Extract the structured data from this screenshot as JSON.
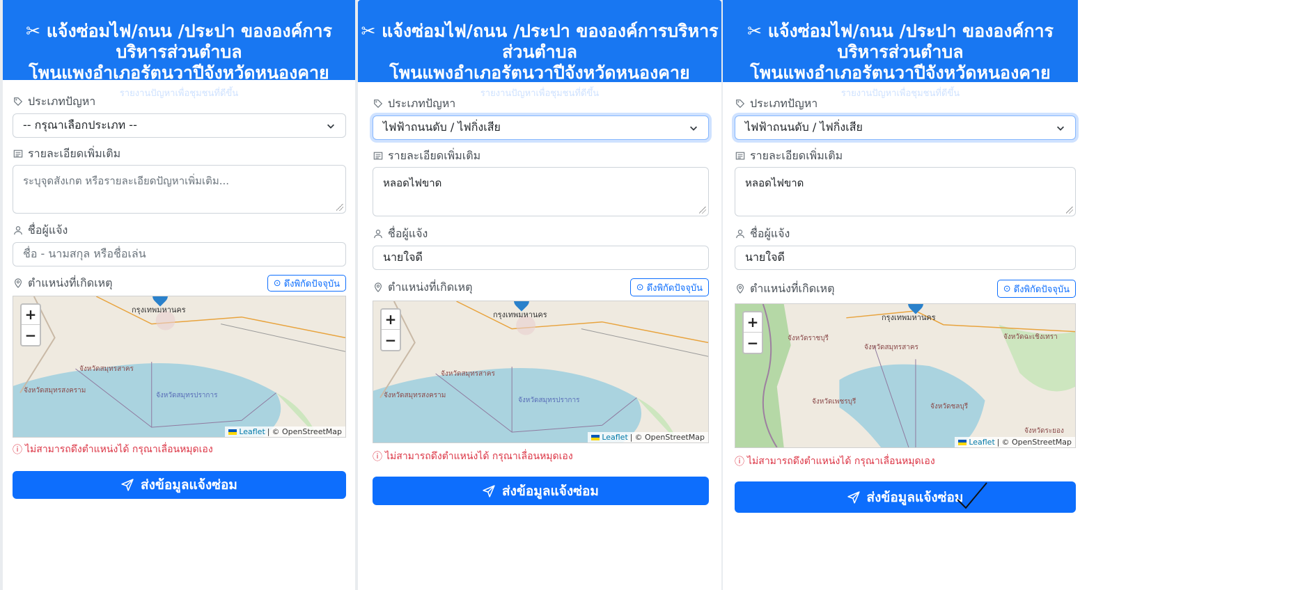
{
  "header": {
    "title_line1": "แจ้งซ่อมไฟ/ถนน /ประปา ขององค์การบริหารส่วนตำบล",
    "title_line2": "โพนแพงอำเภอรัตนวาปีจังหวัดหนองคาย",
    "subtitle": "รายงานปัญหาเพื่อชุมชนที่ดีขึ้น"
  },
  "labels": {
    "category": "ประเภทปัญหา",
    "details": "รายละเอียดเพิ่มเติม",
    "reporter": "ชื่อผู้แจ้ง",
    "location": "ตำแหน่งที่เกิดเหตุ",
    "get_location_button": "ดึงพิกัดปัจจุบัน",
    "location_error": "ไม่สามารถดึงตำแหน่งได้ กรุณาเลื่อนหมุดเอง",
    "submit_button": "ส่งข้อมูลแจ้งซ่อม"
  },
  "map": {
    "zoom_in": "+",
    "zoom_out": "−",
    "attribution_leaflet": "Leaflet",
    "attribution_sep": "|",
    "attribution_osm": "© OpenStreetMap",
    "places": {
      "bangkok": "กรุงเทพมหานคร",
      "samut_sakhon": "จังหวัดสมุทรสาคร",
      "samut_songkhram": "จังหวัดสมุทรสงคราม",
      "samut_prakan": "จังหวัดสมุทรปราการ",
      "chachoengsao": "จังหวัดฉะเชิงเทรา",
      "ratchaburi": "จังหวัดราชบุรี",
      "phetchaburi": "จังหวัดเพชรบุรี",
      "chonburi": "จังหวัดชลบุรี",
      "rayong": "จังหวัดระยอง"
    }
  },
  "screens": [
    {
      "category_value": "-- กรุณาเลือกประเภท --",
      "details_value": "",
      "details_placeholder": "ระบุจุดสังเกต หรือรายละเอียดปัญหาเพิ่มเติม...",
      "reporter_value": "",
      "reporter_placeholder": "ชื่อ - นามสกุล หรือชื่อเล่น"
    },
    {
      "category_value": "ไฟฟ้าถนนดับ / ไฟกิ่งเสีย",
      "details_value": "หลอดไฟขาด",
      "reporter_value": "นายใจดี"
    },
    {
      "category_value": "ไฟฟ้าถนนดับ / ไฟกิ่งเสีย",
      "details_value": "หลอดไฟขาด",
      "reporter_value": "นายใจดี"
    }
  ],
  "colors": {
    "header_bg": "#1877f2",
    "primary": "#0d6efd",
    "error": "#dc3545",
    "sea": "#aad3df"
  },
  "icons": [
    "tools-icon",
    "tag-icon",
    "document-icon",
    "person-icon",
    "location-pin-icon",
    "crosshair-icon",
    "chevron-down-icon",
    "info-icon",
    "send-icon"
  ]
}
